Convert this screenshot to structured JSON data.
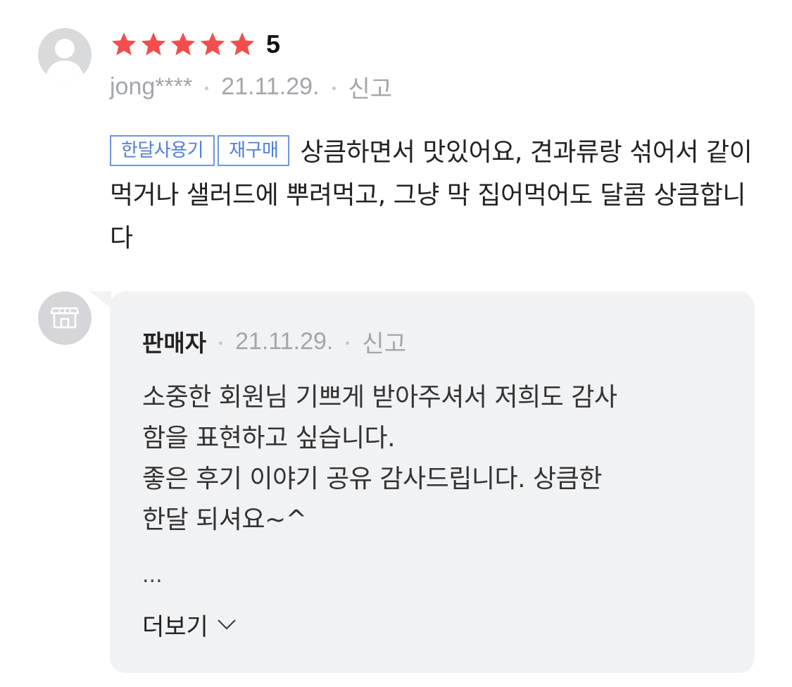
{
  "review": {
    "rating": "5",
    "stars_filled": 5,
    "stars_total": 5,
    "star_color": "#f24e4e",
    "author": "jong****",
    "date": "21.11.29.",
    "report_label": "신고",
    "tags": [
      "한달사용기",
      "재구매"
    ],
    "text": "상큼하면서 맛있어요, 견과류랑 섞어서 같이 먹거나 샐러드에 뿌려먹고, 그냥 막 집어먹어도 달콤 상큼합니다"
  },
  "reply": {
    "seller_label": "판매자",
    "date": "21.11.29.",
    "report_label": "신고",
    "text": "소중한 회원님 기쁘게 받아주셔서 저희도 감사\n함을 표현하고 싶습니다.\n좋은 후기 이야기 공유 감사드립니다.  상큼한\n한달 되셔요~^",
    "ellipsis": "...",
    "more_label": "더보기"
  },
  "colors": {
    "tag_border": "#6f96dc",
    "reply_background": "#f1f2f4",
    "meta_text": "#a3a6ab"
  },
  "icons": {
    "reviewer_avatar": "person-icon",
    "seller_avatar": "store-icon",
    "more": "chevron-down-icon",
    "rating": "star-icon"
  }
}
